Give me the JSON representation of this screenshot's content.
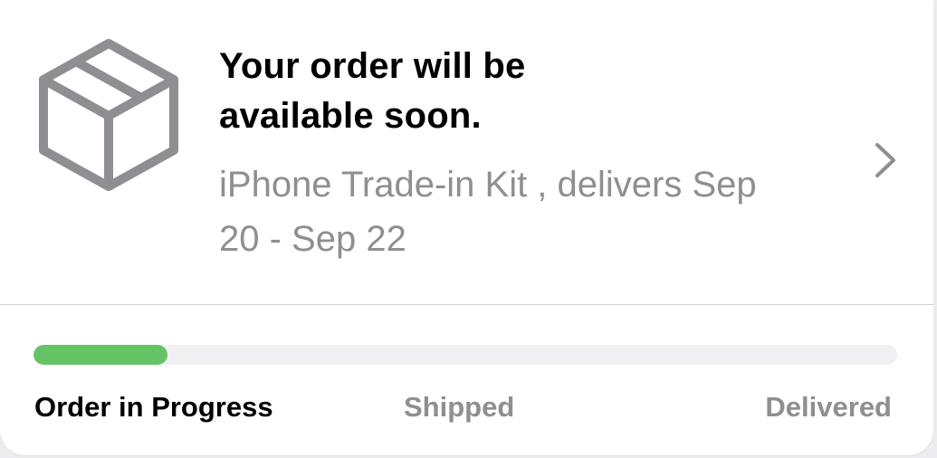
{
  "order": {
    "title_lines": [
      "Your order will be",
      "available soon."
    ],
    "subtitle_lines": [
      "iPhone Trade-in Kit , delivers Sep",
      "20 - Sep 22"
    ],
    "icon": "shipping-box-icon",
    "chevron": "chevron-right-icon"
  },
  "progress": {
    "fraction": 0.155,
    "steps": [
      "Order in Progress",
      "Shipped",
      "Delivered"
    ],
    "current_step": 0
  },
  "colors": {
    "progress_fill": "#66c466",
    "progress_track": "#f0f0f2",
    "secondary_text": "#8e8e93",
    "icon_gray": "#8e8e93"
  }
}
